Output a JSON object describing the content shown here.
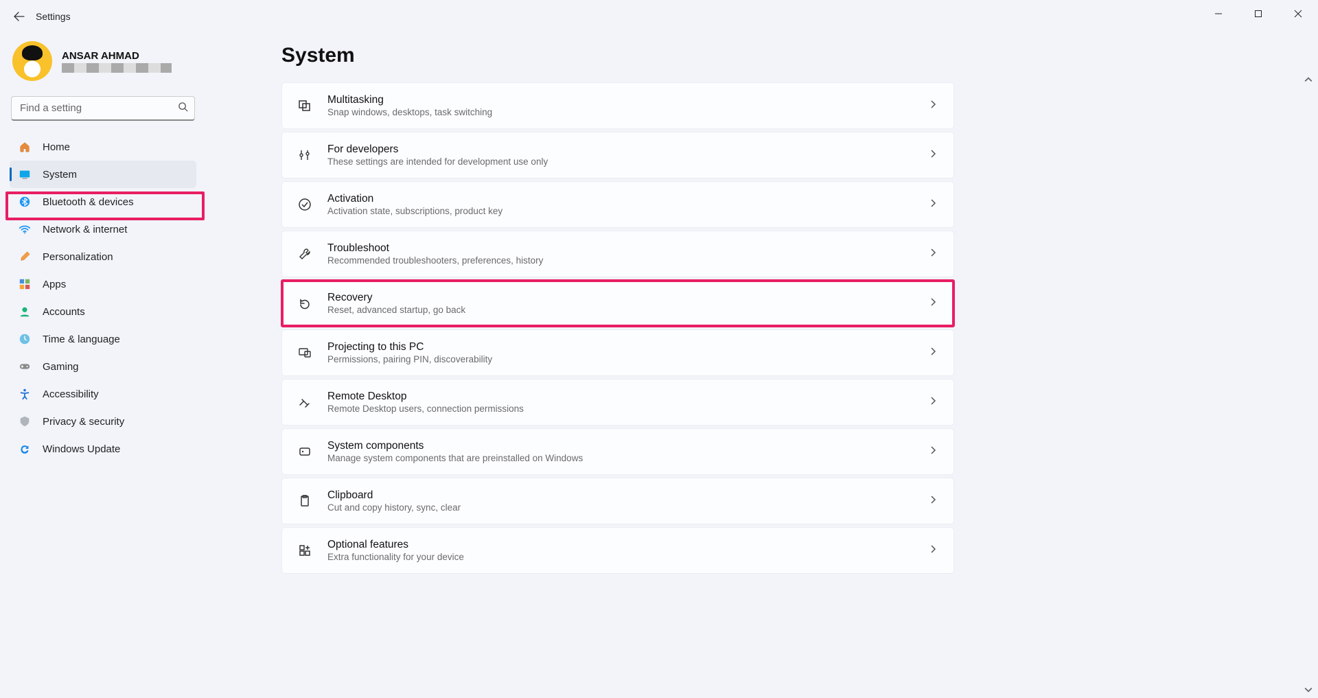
{
  "window": {
    "title": "Settings"
  },
  "profile": {
    "name": "ANSAR AHMAD"
  },
  "search": {
    "placeholder": "Find a setting"
  },
  "nav": {
    "home": "Home",
    "system": "System",
    "bluetooth": "Bluetooth & devices",
    "network": "Network & internet",
    "personalization": "Personalization",
    "apps": "Apps",
    "accounts": "Accounts",
    "time": "Time & language",
    "gaming": "Gaming",
    "accessibility": "Accessibility",
    "privacy": "Privacy & security",
    "update": "Windows Update"
  },
  "page": {
    "title": "System"
  },
  "rows": {
    "multitasking": {
      "title": "Multitasking",
      "desc": "Snap windows, desktops, task switching"
    },
    "developers": {
      "title": "For developers",
      "desc": "These settings are intended for development use only"
    },
    "activation": {
      "title": "Activation",
      "desc": "Activation state, subscriptions, product key"
    },
    "troubleshoot": {
      "title": "Troubleshoot",
      "desc": "Recommended troubleshooters, preferences, history"
    },
    "recovery": {
      "title": "Recovery",
      "desc": "Reset, advanced startup, go back"
    },
    "projecting": {
      "title": "Projecting to this PC",
      "desc": "Permissions, pairing PIN, discoverability"
    },
    "remote": {
      "title": "Remote Desktop",
      "desc": "Remote Desktop users, connection permissions"
    },
    "components": {
      "title": "System components",
      "desc": "Manage system components that are preinstalled on Windows"
    },
    "clipboard": {
      "title": "Clipboard",
      "desc": "Cut and copy history, sync, clear"
    },
    "optional": {
      "title": "Optional features",
      "desc": "Extra functionality for your device"
    }
  },
  "highlights": {
    "nav_index": 1,
    "row_key": "recovery"
  }
}
